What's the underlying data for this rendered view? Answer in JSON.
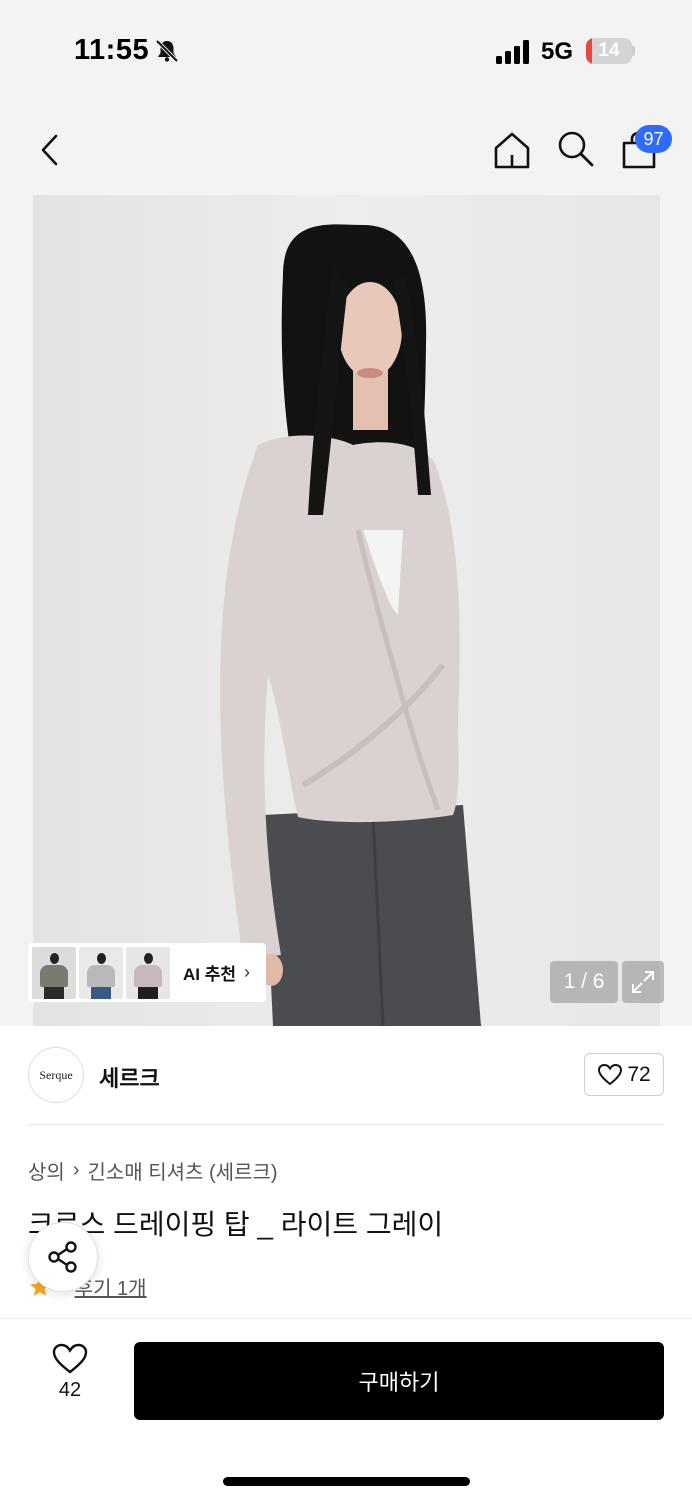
{
  "status_bar": {
    "time": "11:55",
    "network": "5G",
    "battery_level": "14",
    "battery_fraction": 0.14
  },
  "nav": {
    "back_icon": "chevron-left-icon",
    "home_icon": "home-icon",
    "search_icon": "search-icon",
    "cart_icon": "shopping-bag-icon",
    "cart_count": "97"
  },
  "gallery": {
    "ai_recommend_label": "AI 추천",
    "page_counter": "1 / 6",
    "expand_icon": "expand-icon"
  },
  "brand": {
    "logo_text": "Serque",
    "name": "세르크",
    "like_count": "72"
  },
  "product": {
    "breadcrumb": [
      "상의",
      "긴소매 티셔츠 (세르크)"
    ],
    "title": "크로스 드레이핑 탑 _ 라이트 그레이",
    "review_link": "후기 1개"
  },
  "bottom": {
    "wish_count": "42",
    "buy_label": "구매하기"
  },
  "colors": {
    "badge": "#2f6bff",
    "buy_button": "#000000",
    "star": "#f5a623",
    "battery_low": "#e5483e"
  }
}
